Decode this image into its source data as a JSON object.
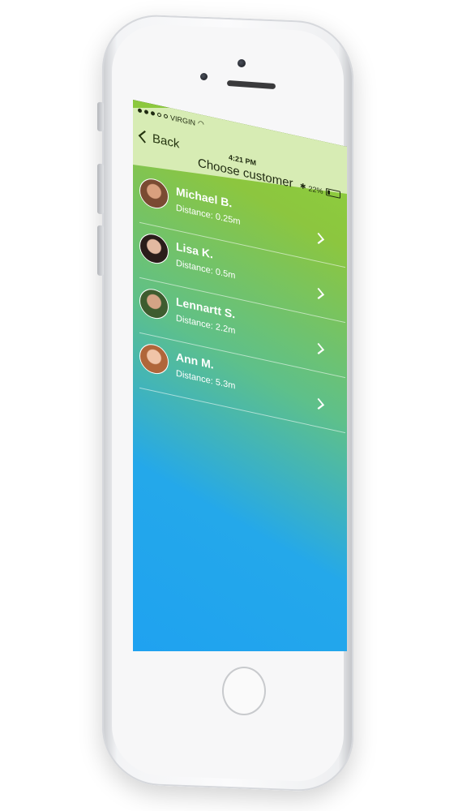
{
  "status_bar": {
    "carrier": "VIRGIN",
    "time": "4:21 PM",
    "battery": "22%",
    "battery_level": 0.22
  },
  "nav": {
    "back_label": "Back",
    "title": "Choose customer"
  },
  "customers": [
    {
      "name": "Michael B.",
      "distance": "Distance: 0.25m",
      "avatar_colors": [
        "#7a4b32",
        "#d9a07e"
      ]
    },
    {
      "name": "Lisa K.",
      "distance": "Distance: 0.5m",
      "avatar_colors": [
        "#2a1d1a",
        "#e2b9a1"
      ]
    },
    {
      "name": "Lennartt S.",
      "distance": "Distance: 2.2m",
      "avatar_colors": [
        "#3e5c2f",
        "#d4a486"
      ]
    },
    {
      "name": "Ann M.",
      "distance": "Distance: 5.3m",
      "avatar_colors": [
        "#b0663a",
        "#f0c4a8"
      ]
    }
  ],
  "colors": {
    "nav_bar": "#d7ecb4",
    "gradient_top": "#8fd43a",
    "gradient_bottom": "#1fa2f0"
  }
}
